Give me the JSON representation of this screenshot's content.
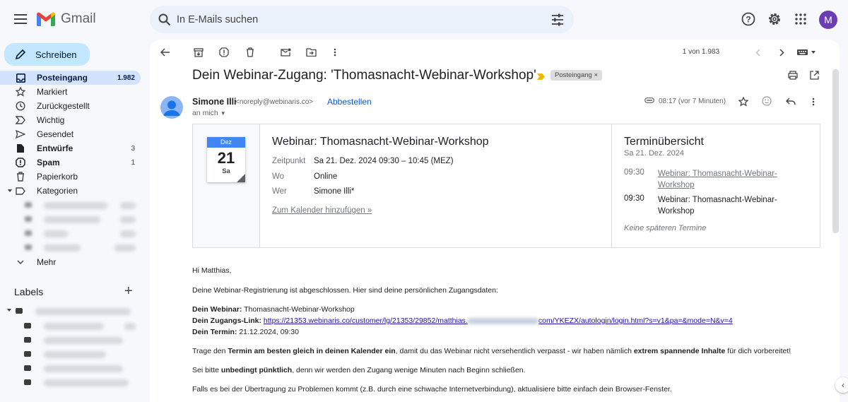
{
  "app": {
    "logo_text": "Gmail",
    "avatar_letter": "M"
  },
  "search": {
    "placeholder": "In E-Mails suchen"
  },
  "compose": {
    "label": "Schreiben"
  },
  "nav": [
    {
      "label": "Posteingang",
      "count": "1.982",
      "icon": "inbox-icon"
    },
    {
      "label": "Markiert",
      "count": "",
      "icon": "star-icon"
    },
    {
      "label": "Zurückgestellt",
      "count": "",
      "icon": "clock-icon"
    },
    {
      "label": "Wichtig",
      "count": "",
      "icon": "important-icon"
    },
    {
      "label": "Gesendet",
      "count": "",
      "icon": "send-icon"
    },
    {
      "label": "Entwürfe",
      "count": "3",
      "icon": "draft-icon"
    },
    {
      "label": "Spam",
      "count": "1",
      "icon": "spam-icon"
    },
    {
      "label": "Papierkorb",
      "count": "",
      "icon": "trash-icon"
    },
    {
      "label": "Kategorien",
      "count": "",
      "icon": "label-icon"
    }
  ],
  "more_label": "Mehr",
  "labels_title": "Labels",
  "pager": "1 von 1.983",
  "email": {
    "subject": "Dein Webinar-Zugang: 'Thomasnacht-Webinar-Workshop'",
    "tag": "Posteingang",
    "sender_name": "Simone Illi",
    "sender_email": "<noreply@webinaris.co>",
    "unsubscribe": "Abbestellen",
    "to": "an mich",
    "time": "08:17 (vor 7 Minuten)"
  },
  "event": {
    "month": "Dez",
    "day": "21",
    "weekday": "Sa",
    "title": "Webinar: Thomasnacht-Webinar-Workshop",
    "when_label": "Zeitpunkt",
    "when": "Sa 21. Dez. 2024 09:30 – 10:45 (MEZ)",
    "where_label": "Wo",
    "where": "Online",
    "who_label": "Wer",
    "who": "Simone Illi*",
    "add_calendar": "Zum Kalender hinzufügen »"
  },
  "agenda": {
    "title": "Terminübersicht",
    "date": "Sa 21. Dez. 2024",
    "items": [
      {
        "time": "09:30",
        "name": "Webinar: Thomasnacht-Webinar-Workshop"
      },
      {
        "time": "09:30",
        "name": "Webinar: Thomasnacht-Webinar-Workshop"
      }
    ],
    "no_more": "Keine späteren Termine"
  },
  "body": {
    "greeting": "Hi Matthias,",
    "intro": "Deine Webinar-Registrierung ist abgeschlossen. Hier sind deine persönlichen Zugangsdaten:",
    "webinar_label": "Dein Webinar:",
    "webinar_value": "Thomasnacht-Webinar-Workshop",
    "link_label": "Dein Zugangs-Link:",
    "link_start": "https://21353.webinaris.co/customer/lg/21353/29852/matthias.",
    "link_end": "com/YKEZX/autologin/login.html?s=v1&pa=&mode=N&v=4",
    "date_label": "Dein Termin:",
    "date_value": "21.12.2024, 09:30",
    "p1_a": "Trage den ",
    "p1_b": "Termin am besten gleich in deinen Kalender ein",
    "p1_c": ", damit du das Webinar nicht versehentlich verpasst - wir haben nämlich ",
    "p1_d": "extrem spannende Inhalte",
    "p1_e": " für dich vorbereitet!",
    "p2_a": "Sei bitte ",
    "p2_b": "unbedingt pünktlich",
    "p2_c": ", denn wir werden den Zugang wenige Minuten nach Beginn schließen.",
    "p3": "Falls es bei der Übertragung zu Problemen kommt (z.B. durch eine schwache Internetverbindung), aktualisiere bitte einfach dein Browser-Fenster."
  }
}
